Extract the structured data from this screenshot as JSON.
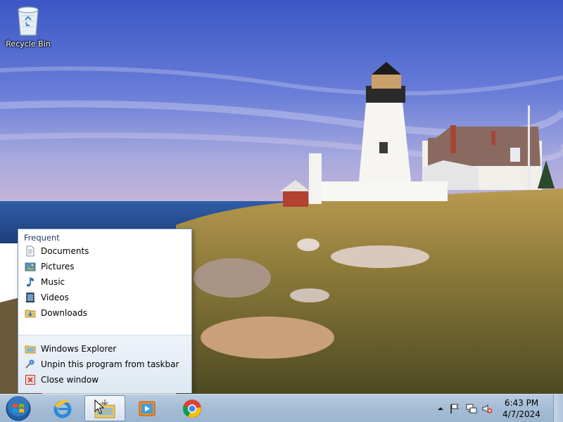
{
  "desktop": {
    "icons": [
      {
        "label": "Recycle Bin",
        "icon": "recycle-bin-icon"
      }
    ]
  },
  "jumplist": {
    "category": "Frequent",
    "frequent": [
      {
        "label": "Documents",
        "icon": "documents-icon"
      },
      {
        "label": "Pictures",
        "icon": "pictures-icon"
      },
      {
        "label": "Music",
        "icon": "music-icon"
      },
      {
        "label": "Videos",
        "icon": "videos-icon"
      },
      {
        "label": "Downloads",
        "icon": "downloads-icon"
      }
    ],
    "tasks": [
      {
        "label": "Windows Explorer",
        "icon": "folder-icon"
      },
      {
        "label": "Unpin this program from taskbar",
        "icon": "unpin-icon"
      },
      {
        "label": "Close window",
        "icon": "close-window-icon"
      }
    ]
  },
  "taskbar": {
    "pinned": [
      {
        "icon": "internet-explorer-icon",
        "active": false
      },
      {
        "icon": "windows-explorer-icon",
        "active": true
      },
      {
        "icon": "media-player-icon",
        "active": false
      },
      {
        "icon": "chrome-icon",
        "active": false
      }
    ],
    "clock": {
      "time": "6:43 PM",
      "date": "4/7/2024"
    }
  }
}
